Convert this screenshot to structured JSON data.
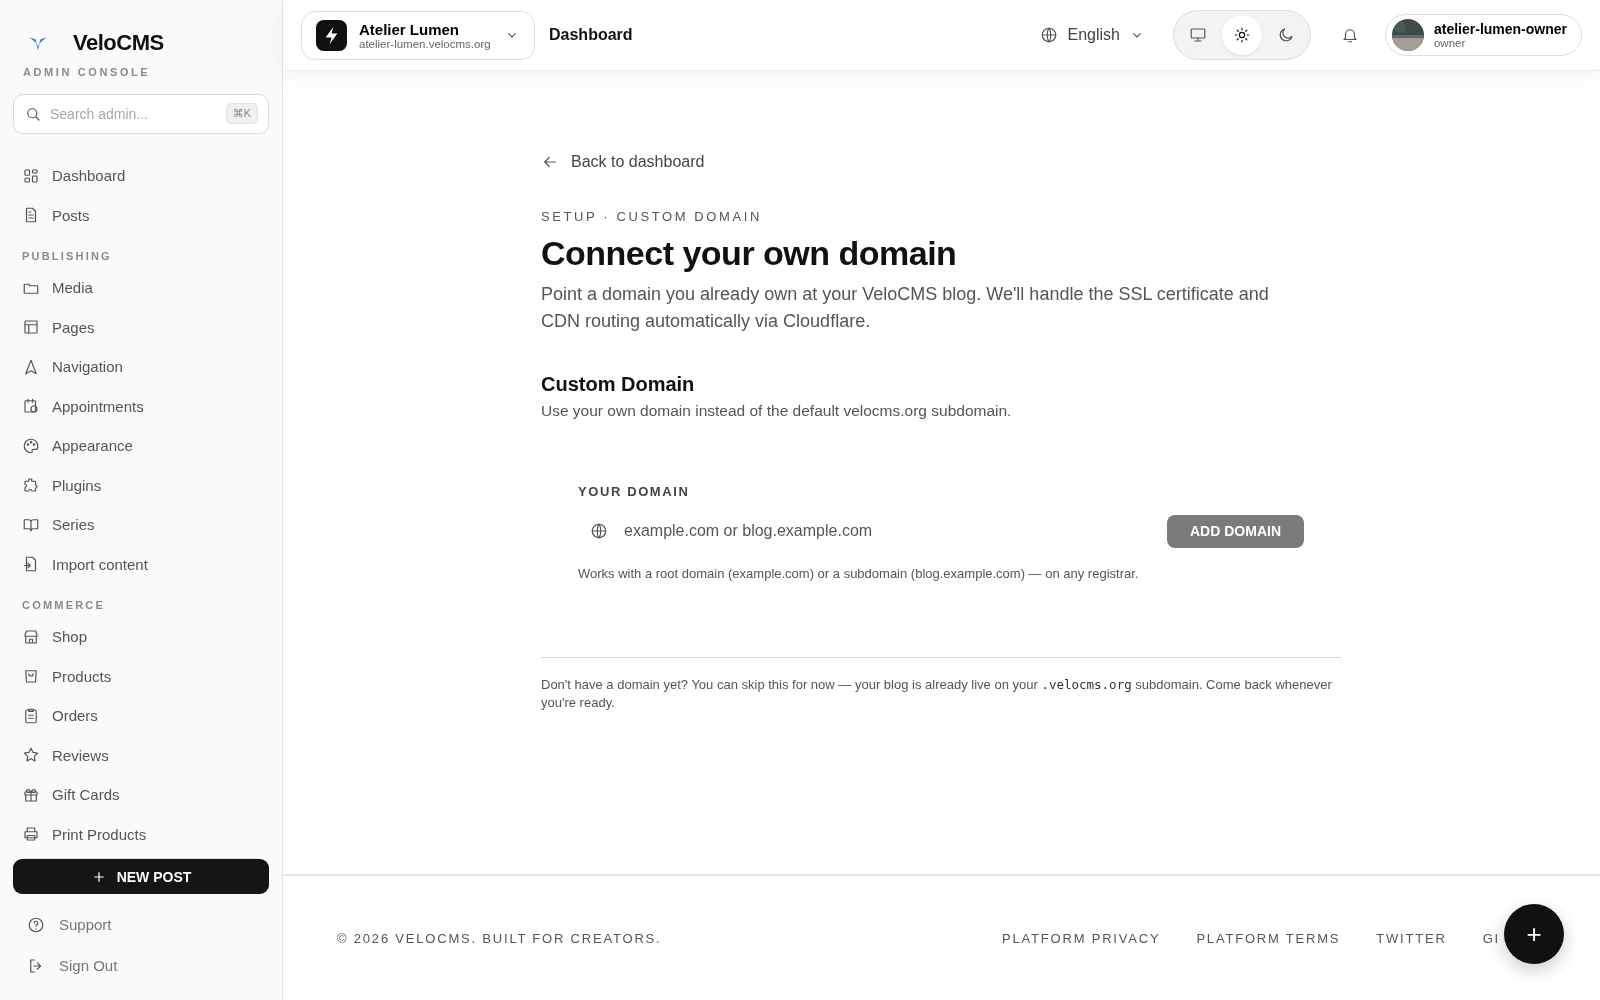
{
  "sidebar": {
    "logo": "VeloCMS",
    "subtitle": "ADMIN CONSOLE",
    "search": {
      "placeholder": "Search admin...",
      "shortcut": "⌘K"
    },
    "sections": [
      {
        "items": [
          {
            "label": "Dashboard"
          },
          {
            "label": "Posts"
          }
        ]
      },
      {
        "heading": "PUBLISHING",
        "items": [
          {
            "label": "Media"
          },
          {
            "label": "Pages"
          },
          {
            "label": "Navigation"
          },
          {
            "label": "Appointments"
          },
          {
            "label": "Appearance"
          },
          {
            "label": "Plugins"
          },
          {
            "label": "Series"
          },
          {
            "label": "Import content"
          }
        ]
      },
      {
        "heading": "COMMERCE",
        "items": [
          {
            "label": "Shop"
          },
          {
            "label": "Products"
          },
          {
            "label": "Orders"
          },
          {
            "label": "Reviews"
          },
          {
            "label": "Gift Cards"
          },
          {
            "label": "Print Products"
          }
        ]
      }
    ],
    "new_post": "NEW POST",
    "bottom_links": [
      {
        "label": "Support"
      },
      {
        "label": "Sign Out"
      }
    ]
  },
  "header": {
    "site": {
      "name": "Atelier Lumen",
      "domain": "atelier-lumen.velocms.org"
    },
    "page_title": "Dashboard",
    "language": "English",
    "theme_switcher": [
      {
        "selected": false
      },
      {
        "selected": true
      },
      {
        "selected": false
      }
    ],
    "user": {
      "name": "atelier-lumen-owner",
      "role": "owner"
    }
  },
  "main": {
    "back_link": "Back to dashboard",
    "eyebrow": "SETUP · CUSTOM DOMAIN",
    "title": "Connect your own domain",
    "intro": "Point a domain you already own at your VeloCMS blog. We'll handle the SSL certificate and CDN routing automatically via Cloudflare.",
    "section_title": "Custom Domain",
    "section_subtitle": "Use your own domain instead of the default velocms.org subdomain.",
    "domain_label": "YOUR DOMAIN",
    "domain_placeholder": "example.com or blog.example.com",
    "add_button": "ADD DOMAIN",
    "add_disabled": true,
    "hint": "Works with a root domain (example.com) or a subdomain (blog.example.com) — on any registrar.",
    "note": {
      "before": "Don't have a domain yet? You can skip this for now — your blog is already live on your ",
      "code": ".velocms.org",
      "after": " subdomain. Come back whenever you're ready."
    }
  },
  "footer": {
    "copyright": "© 2026 VELOCMS. BUILT FOR CREATORS.",
    "links": [
      "PLATFORM PRIVACY",
      "PLATFORM TERMS",
      "TWITTER",
      "GI"
    ],
    "fab": "+"
  }
}
